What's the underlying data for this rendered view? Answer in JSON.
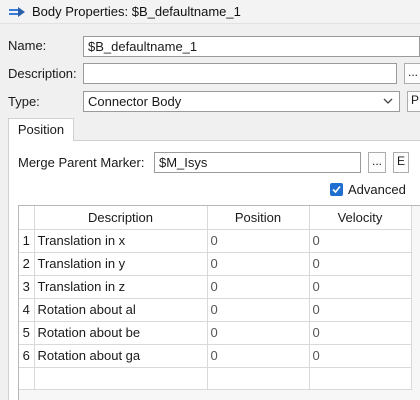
{
  "window": {
    "title": "Body Properties: $B_defaultname_1"
  },
  "form": {
    "name_label": "Name:",
    "name_value": "$B_defaultname_1",
    "description_label": "Description:",
    "description_value": "",
    "description_button": "...",
    "type_label": "Type:",
    "type_value": "Connector Body",
    "type_side_button": "P"
  },
  "tabs": [
    {
      "label": "Position",
      "active": true
    }
  ],
  "position_tab": {
    "merge_label": "Merge Parent Marker:",
    "merge_value": "$M_Isys",
    "merge_browse_button": "...",
    "merge_edit_button": "E",
    "advanced_label": "Advanced",
    "advanced_checked": true
  },
  "table": {
    "columns": [
      "",
      "Description",
      "Position",
      "Velocity"
    ],
    "rows": [
      {
        "index": "1",
        "description": "Translation in x",
        "position": "0",
        "velocity": "0"
      },
      {
        "index": "2",
        "description": "Translation in y",
        "position": "0",
        "velocity": "0"
      },
      {
        "index": "3",
        "description": "Translation in z",
        "position": "0",
        "velocity": "0"
      },
      {
        "index": "4",
        "description": "Rotation about al",
        "position": "0",
        "velocity": "0"
      },
      {
        "index": "5",
        "description": "Rotation about be",
        "position": "0",
        "velocity": "0"
      },
      {
        "index": "6",
        "description": "Rotation about ga",
        "position": "0",
        "velocity": "0"
      }
    ]
  },
  "colors": {
    "accent": "#1f6fd1",
    "window_bg": "#f0f0f0",
    "panel_bg": "#ffffff"
  },
  "icons": {
    "app": "app-logo-icon",
    "dropdown": "chevron-down-icon",
    "checkbox": "checkmark-icon"
  }
}
